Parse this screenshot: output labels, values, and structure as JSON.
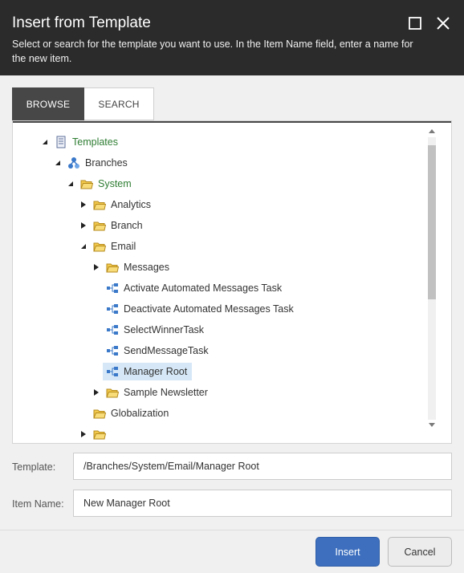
{
  "dialog": {
    "title": "Insert from Template",
    "description": "Select or search for the template you want to use. In the Item Name field, enter a name for the new item."
  },
  "tabs": [
    {
      "label": "BROWSE",
      "active": true
    },
    {
      "label": "SEARCH",
      "active": false
    }
  ],
  "tree": {
    "items": [
      {
        "label": "Templates",
        "expander": "expanded",
        "icon": "templates-icon",
        "label_color": "#2e7d32"
      },
      {
        "label": "Branches",
        "expander": "expanded",
        "icon": "branches-icon"
      },
      {
        "label": "System",
        "expander": "expanded",
        "icon": "folder-icon",
        "label_color": "#2e7d32"
      },
      {
        "label": "Analytics",
        "expander": "collapsed",
        "icon": "folder-icon"
      },
      {
        "label": "Branch",
        "expander": "collapsed",
        "icon": "folder-icon"
      },
      {
        "label": "Email",
        "expander": "expanded",
        "icon": "folder-icon"
      },
      {
        "label": "Messages",
        "expander": "collapsed",
        "icon": "folder-icon"
      },
      {
        "label": "Activate Automated Messages Task",
        "expander": "none",
        "icon": "branch-template-icon"
      },
      {
        "label": "Deactivate Automated Messages Task",
        "expander": "none",
        "icon": "branch-template-icon"
      },
      {
        "label": "SelectWinnerTask",
        "expander": "none",
        "icon": "branch-template-icon"
      },
      {
        "label": "SendMessageTask",
        "expander": "none",
        "icon": "branch-template-icon"
      },
      {
        "label": "Manager Root",
        "expander": "none",
        "icon": "branch-template-icon",
        "selected": true
      },
      {
        "label": "Sample Newsletter",
        "expander": "collapsed",
        "icon": "folder-icon"
      },
      {
        "label": "Globalization",
        "expander": "none",
        "icon": "folder-icon"
      },
      {
        "label": "",
        "expander": "collapsed",
        "icon": "folder-icon"
      }
    ]
  },
  "form": {
    "template_label": "Template:",
    "template_value": "/Branches/System/Email/Manager Root",
    "item_name_label": "Item Name:",
    "item_name_value": "New Manager Root"
  },
  "buttons": {
    "insert_label": "Insert",
    "cancel_label": "Cancel"
  },
  "colors": {
    "header_bg": "#2b2b2b",
    "active_tab_bg": "#474747",
    "primary_button": "#3d6fbe",
    "selection_bg": "#d6e8f7",
    "green_label": "#2e7d32"
  }
}
